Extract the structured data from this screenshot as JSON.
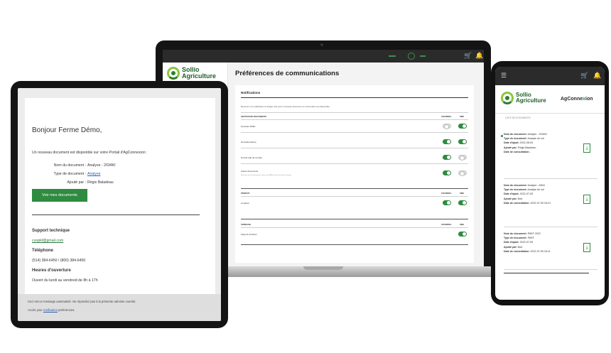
{
  "laptop": {
    "brand_line1": "Sollio",
    "brand_line2": "Agriculture",
    "title": "Préférences de communications",
    "card_title": "Notifications",
    "card_desc": "Recevez une notification à chaque fois qu'un nouveau document ou information est disponible.",
    "col_email": "COURRIEL",
    "col_sms": "SMS",
    "sections": [
      {
        "heading": "GESTION DE DOCUMENTS",
        "rows": [
          {
            "label": "Nouveau PAEF",
            "email": false,
            "sms": true
          },
          {
            "label": "Nouvelle facture",
            "email": true,
            "sms": true
          },
          {
            "label": "Nouvel état de compte",
            "email": true,
            "sms": false
          },
          {
            "label": "Autres documents",
            "sub": "Recevez tous les documents autres que PAEF, facture ou état de compte.",
            "email": true,
            "sms": false
          }
        ]
      },
      {
        "heading": "PRODUIT",
        "rows": [
          {
            "label": "Livraison",
            "email": true,
            "sms": true
          }
        ]
      },
      {
        "heading": "SONDAGE",
        "rows": [
          {
            "label": "Sujet de livraison",
            "email": null,
            "sms": true
          }
        ]
      }
    ]
  },
  "tablet": {
    "greeting": "Bonjour Ferme Démo,",
    "intro": "Un nouveau document est disponible sur votre Portail d'AgConnexion :",
    "fields": [
      {
        "label": "Nom du document :",
        "value": "Analyse - 2034KI",
        "link": false
      },
      {
        "label": "Type de document :",
        "value": "Analyse",
        "link": true
      },
      {
        "label": "Ajouté par :",
        "value": "Régis Baladeau",
        "link": false
      }
    ],
    "button": "Voir mes documents",
    "support_heading": "Support technique",
    "support_email": "coopkf@gmail.com",
    "phone_heading": "Téléphone",
    "phone_numbers": "(514) 384-6450 / (800) 384-6450",
    "hours_heading": "Heures d'ouverture",
    "hours": "Ouvert du lundi au vendredi de 8h à 17h",
    "footer_line1": "Ceci est un message automatisé. Ne répondez pas à la présente adresse courriel.",
    "footer_prefix": "Accès your",
    "footer_link": "notification",
    "footer_suffix": "preferences."
  },
  "phone": {
    "brand_line1": "Sollio",
    "brand_line2": "Agriculture",
    "agc_part1": "AgConne",
    "agc_part2": "x",
    "agc_part3": "ion",
    "partial_text": "LISTE DE DOCUMENTS",
    "documents": [
      {
        "name_label": "Nom du document:",
        "name": "Analyse - 2034KI",
        "type_label": "Type de document:",
        "type": "Analyse de sol",
        "added_date_label": "Date d'ajout:",
        "added_date": "2022-08-09",
        "added_by_label": "Ajouté par:",
        "added_by": "Régis Baladeau",
        "consult_label": "Date de consultation:",
        "consult": "-"
      },
      {
        "name_label": "Nom du document:",
        "name": "Analyse - A504",
        "type_label": "Type de document:",
        "type": "Analyse de sol",
        "added_date_label": "Date d'ajout:",
        "added_date": "2022-07-05",
        "added_by_label": "Ajouté par:",
        "added_by": "Bob",
        "consult_label": "Date de consultation:",
        "consult": "2022-07-05 18:13"
      },
      {
        "name_label": "Nom du document:",
        "name": "PAEF 2022",
        "type_label": "Type de document:",
        "type": "PAEF",
        "added_date_label": "Date d'ajout:",
        "added_date": "2022-07-05",
        "added_by_label": "Ajouté par:",
        "added_by": "Bob",
        "consult_label": "Date de consultation:",
        "consult": "2022-07-05 18:11"
      }
    ]
  },
  "icons": {
    "menu": "☰",
    "cart": "🛒",
    "bell": "🔔",
    "download": "⤓"
  },
  "colors": {
    "brand_green": "#2e8b3f",
    "dark_bar": "#2b2b2b",
    "link_blue": "#2a5db0"
  }
}
